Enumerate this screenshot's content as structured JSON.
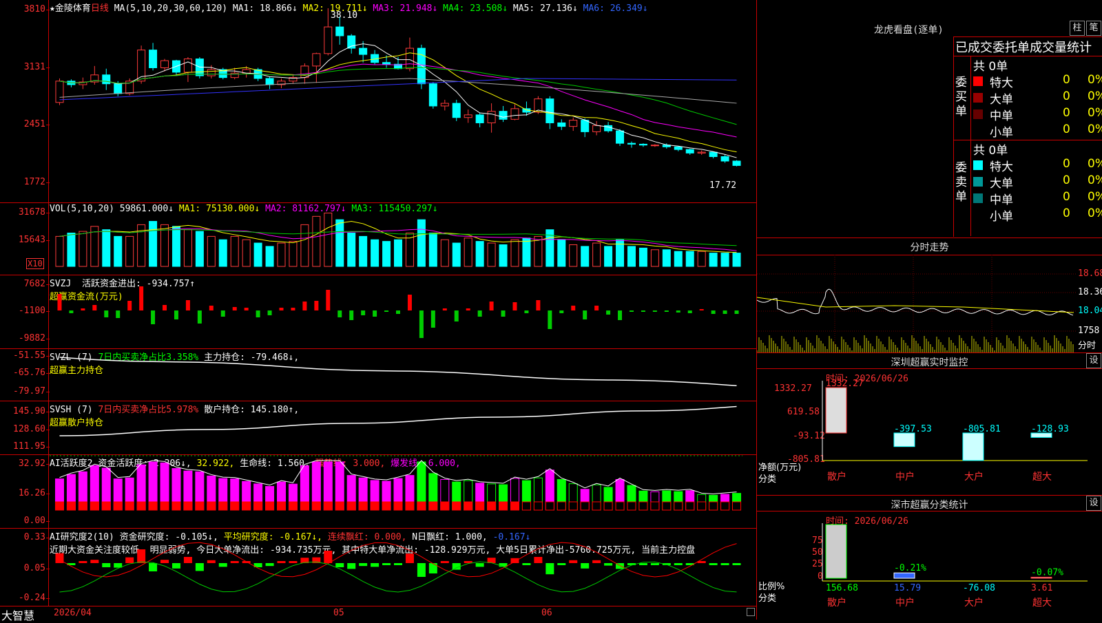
{
  "colors": {
    "up": "#ff3b3b",
    "down": "#00ffff",
    "ma1": "#ffffff",
    "ma2": "#ffff00",
    "ma3": "#ff00ff",
    "ma4": "#00cc00",
    "ma5": "#aaaaaa",
    "ma6": "#3333ff",
    "grid": "#cc0000"
  },
  "main": {
    "stock_name": "金陵体育",
    "period": "日线",
    "ma_label": "MA(5,10,20,30,60,120)",
    "ma1": "MA1: 18.866↓",
    "ma2": "MA2: 19.711↓",
    "ma3": "MA3: 21.948↓",
    "ma4": "MA4: 23.508↓",
    "ma5": "MA5: 27.136↓",
    "ma6": "MA6: 26.349↓",
    "high_label": "38.10",
    "low_label": "17.72",
    "yticks": [
      "3810",
      "3131",
      "2451",
      "1772"
    ]
  },
  "vol": {
    "label": "VOL(5,10,20)",
    "value": "59861.000↓",
    "ma1": "MA1: 75130.000↓",
    "ma2": "MA2: 81162.797↓",
    "ma3": "MA3: 115450.297↓",
    "yticks": [
      "31678",
      "15643"
    ],
    "unit": "X10"
  },
  "svzj": {
    "label": "SVZJ",
    "text": "活跃资金进出: -934.757↑",
    "sub": "超赢资金流(万元)",
    "yticks": [
      "7682",
      "-1100",
      "-9882"
    ]
  },
  "svzl": {
    "label": "SVZL (7)",
    "text": "7日内买卖净占比3.358%",
    "hold": "主力持仓: -79.468↓,",
    "sub": "超赢主力持仓",
    "yticks": [
      "-51.55",
      "-65.76",
      "-79.97"
    ]
  },
  "svsh": {
    "label": "SVSH (7)",
    "text": "7日内买卖净占比5.978%",
    "hold": "散户持仓: 145.180↑,",
    "sub": "超赢散户持仓",
    "yticks": [
      "145.90",
      "128.60",
      "111.95"
    ]
  },
  "ai1": {
    "label": "AI活跃度2",
    "a": "资金活跃度: 2.206↓,",
    "b": "32.922,",
    "c": "生命线: 1.560,",
    "d": "强势线: 3.000,",
    "e": "爆发线: 6.000,",
    "yticks": [
      "32.92",
      "16.26",
      "0.00"
    ]
  },
  "ai2": {
    "label": "AI研究度2(10)",
    "a": "资金研究度: -0.105↓,",
    "b": "平均研究度: -0.167↓,",
    "c": "连续飘红: 0.000,",
    "d": "N日飘红: 1.000,",
    "e": "-0.167↓",
    "desc": "近期大资金关注度较低, 明显弱势, 今日大单净流出: -934.735万元, 其中特大单净流出: -128.929万元, 大单5日累计净出-5760.725万元, 当前主力控盘",
    "yticks": [
      "0.33",
      "0.05",
      "-0.24"
    ]
  },
  "bottom": {
    "brand": "大智慧",
    "d1": "2026/04",
    "d2": "05",
    "d3": "06"
  },
  "right": {
    "lh_title": "龙虎看盘(逐单)",
    "btn1": "柱",
    "btn2": "笔",
    "stat_title": "已成交委托单成交量统计",
    "buy_label": "委买单",
    "sell_label": "委卖单",
    "buy_total": "共 0单",
    "sell_total": "共 0单",
    "buy_rows": [
      {
        "name": "特大",
        "v": "0",
        "p": "0%",
        "c": "#ff0000"
      },
      {
        "name": "大单",
        "v": "0",
        "p": "0%",
        "c": "#990000"
      },
      {
        "name": "中单",
        "v": "0",
        "p": "0%",
        "c": "#660000"
      },
      {
        "name": "小单",
        "v": "0",
        "p": "0%",
        "c": "#000000"
      }
    ],
    "sell_rows": [
      {
        "name": "特大",
        "v": "0",
        "p": "0%",
        "c": "#00ffff"
      },
      {
        "name": "大单",
        "v": "0",
        "p": "0%",
        "c": "#009999"
      },
      {
        "name": "中单",
        "v": "0",
        "p": "0%",
        "c": "#007777"
      },
      {
        "name": "小单",
        "v": "0",
        "p": "0%",
        "c": "#000000"
      }
    ],
    "fs_title": "分时走势",
    "fs_ticks": [
      "18.68",
      "18.36",
      "18.04",
      "1758",
      "分时"
    ],
    "sz_title": "深圳超赢实时监控",
    "set": "设",
    "sz_time": "时间: 2026/06/26",
    "sz_yticks": [
      "1332.27",
      "619.58",
      "-93.12",
      "-805.81"
    ],
    "sz_values": [
      {
        "cat": "散户",
        "label": "1332.27",
        "v": 1332.27
      },
      {
        "cat": "中户",
        "label": "-397.53",
        "v": -397.53
      },
      {
        "cat": "大户",
        "label": "-805.81",
        "v": -805.81
      },
      {
        "cat": "超大",
        "label": "-128.93",
        "v": -128.93
      }
    ],
    "sz_ylabel": "净额(万元)",
    "sz_xlabel": "分类",
    "cls_title": "深市超赢分类统计",
    "cls_time": "时间: 2026/06/26",
    "cls_yticks": [
      "75",
      "50",
      "25",
      "0"
    ],
    "cls_values": [
      {
        "cat": "散户",
        "label": "156.68",
        "top": "",
        "v": 100
      },
      {
        "cat": "中户",
        "label": "15.79",
        "top": "-0.21%",
        "v": 10
      },
      {
        "cat": "大户",
        "label": "-76.08",
        "top": "",
        "v": 0
      },
      {
        "cat": "超大",
        "label": "3.61",
        "top": "-0.07%",
        "v": 2
      }
    ],
    "cls_ylabel": "比例%",
    "cls_xlabel": "分类"
  },
  "chart_data": {
    "type": "candlestick",
    "ohlc": [
      [
        27.5,
        30.2,
        27.2,
        29.9
      ],
      [
        29.9,
        30.1,
        29.2,
        29.5
      ],
      [
        29.5,
        30.3,
        29.0,
        29.8
      ],
      [
        29.8,
        31.6,
        29.5,
        30.6
      ],
      [
        30.6,
        31.3,
        28.9,
        29.6
      ],
      [
        29.6,
        29.9,
        28.2,
        28.5
      ],
      [
        28.5,
        30.2,
        28.3,
        29.9
      ],
      [
        29.9,
        33.9,
        29.6,
        33.4
      ],
      [
        33.4,
        34.2,
        31.1,
        31.4
      ],
      [
        31.4,
        32.4,
        31.0,
        32.2
      ],
      [
        32.2,
        32.3,
        30.5,
        30.9
      ],
      [
        30.9,
        32.6,
        29.8,
        32.4
      ],
      [
        32.4,
        32.6,
        30.2,
        30.5
      ],
      [
        30.5,
        31.7,
        30.2,
        31.2
      ],
      [
        31.2,
        31.4,
        30.1,
        30.3
      ],
      [
        30.3,
        31.4,
        30.1,
        30.8
      ],
      [
        30.8,
        31.6,
        30.3,
        31.2
      ],
      [
        31.2,
        31.4,
        29.9,
        30.2
      ],
      [
        30.2,
        30.4,
        29.0,
        29.5
      ],
      [
        29.5,
        30.2,
        29.1,
        29.9
      ],
      [
        29.9,
        30.6,
        29.6,
        30.3
      ],
      [
        30.3,
        31.9,
        29.6,
        31.6
      ],
      [
        31.6,
        33.1,
        29.7,
        33.0
      ],
      [
        33.0,
        38.1,
        32.8,
        36.0
      ],
      [
        36.0,
        37.1,
        34.0,
        35.0
      ],
      [
        35.0,
        35.2,
        33.0,
        33.6
      ],
      [
        33.6,
        34.4,
        32.0,
        32.9
      ],
      [
        32.9,
        33.4,
        31.8,
        32.0
      ],
      [
        32.0,
        32.8,
        31.4,
        31.8
      ],
      [
        31.8,
        32.6,
        31.2,
        31.3
      ],
      [
        31.3,
        34.8,
        31.0,
        33.6
      ],
      [
        33.6,
        34.0,
        29.0,
        29.6
      ],
      [
        29.6,
        29.8,
        26.8,
        27.1
      ],
      [
        27.1,
        27.8,
        26.6,
        27.4
      ],
      [
        27.4,
        27.8,
        25.4,
        25.8
      ],
      [
        25.8,
        26.7,
        25.2,
        26.1
      ],
      [
        26.1,
        26.3,
        24.7,
        25.2
      ],
      [
        25.2,
        27.4,
        24.1,
        26.5
      ],
      [
        26.5,
        27.1,
        25.3,
        25.6
      ],
      [
        25.6,
        27.3,
        25.5,
        26.8
      ],
      [
        26.8,
        27.6,
        26.0,
        26.4
      ],
      [
        26.4,
        28.2,
        26.2,
        27.9
      ],
      [
        27.9,
        28.2,
        24.5,
        25.2
      ],
      [
        25.2,
        25.6,
        24.4,
        24.8
      ],
      [
        24.8,
        25.8,
        24.3,
        25.5
      ],
      [
        25.5,
        25.7,
        23.6,
        24.2
      ],
      [
        24.2,
        25.4,
        23.8,
        24.9
      ],
      [
        24.9,
        25.3,
        24.1,
        24.3
      ],
      [
        24.3,
        24.5,
        22.6,
        22.9
      ],
      [
        22.9,
        23.1,
        22.4,
        22.8
      ],
      [
        22.8,
        22.9,
        22.5,
        22.7
      ],
      [
        22.7,
        22.8,
        22.5,
        22.7
      ],
      [
        22.7,
        22.9,
        22.3,
        22.5
      ],
      [
        22.5,
        22.6,
        22.0,
        22.2
      ],
      [
        22.2,
        22.3,
        21.6,
        21.8
      ],
      [
        21.8,
        22.1,
        21.6,
        21.9
      ],
      [
        21.9,
        21.9,
        21.2,
        21.4
      ],
      [
        21.4,
        21.6,
        20.7,
        20.9
      ],
      [
        20.9,
        21.0,
        20.3,
        20.4
      ]
    ]
  }
}
